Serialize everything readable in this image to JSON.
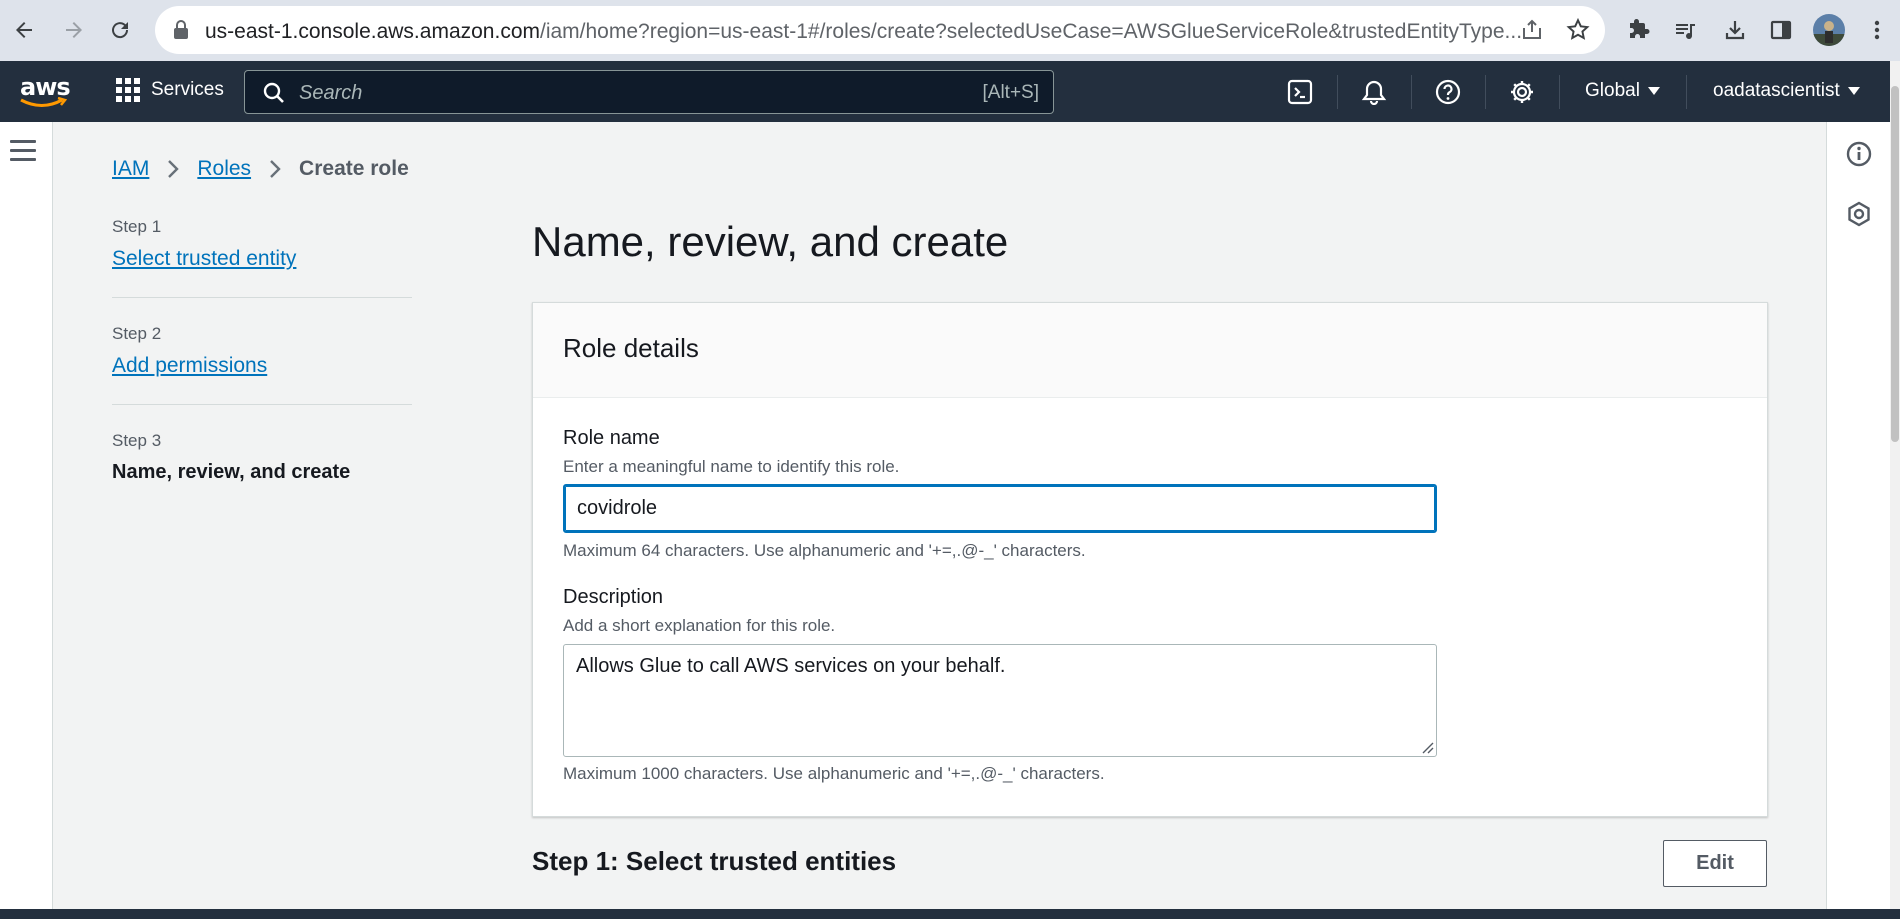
{
  "browser": {
    "url_domain": "us-east-1.console.aws.amazon.com",
    "url_path": "/iam/home?region=us-east-1#/roles/create?selectedUseCase=AWSGlueServiceRole&trustedEntityType..."
  },
  "header": {
    "logo": "aws",
    "services_label": "Services",
    "search_placeholder": "Search",
    "search_shortcut": "[Alt+S]",
    "region": "Global",
    "account": "oadatascientist"
  },
  "breadcrumb": {
    "items": [
      "IAM",
      "Roles"
    ],
    "current": "Create role"
  },
  "steps": [
    {
      "num": "Step 1",
      "label": "Select trusted entity"
    },
    {
      "num": "Step 2",
      "label": "Add permissions"
    },
    {
      "num": "Step 3",
      "label": "Name, review, and create"
    }
  ],
  "main": {
    "title": "Name, review, and create",
    "panel_title": "Role details",
    "role_name": {
      "label": "Role name",
      "hint": "Enter a meaningful name to identify this role.",
      "value": "covidrole",
      "constraint": "Maximum 64 characters. Use alphanumeric and '+=,.@-_' characters."
    },
    "description": {
      "label": "Description",
      "hint": "Add a short explanation for this role.",
      "value": "Allows Glue to call AWS services on your behalf.",
      "constraint": "Maximum 1000 characters. Use alphanumeric and '+=,.@-_' characters."
    },
    "section_title": "Step 1: Select trusted entities",
    "edit_label": "Edit"
  },
  "colors": {
    "aws_header": "#232f3e",
    "link": "#0073bb",
    "focus": "#0073bb"
  }
}
